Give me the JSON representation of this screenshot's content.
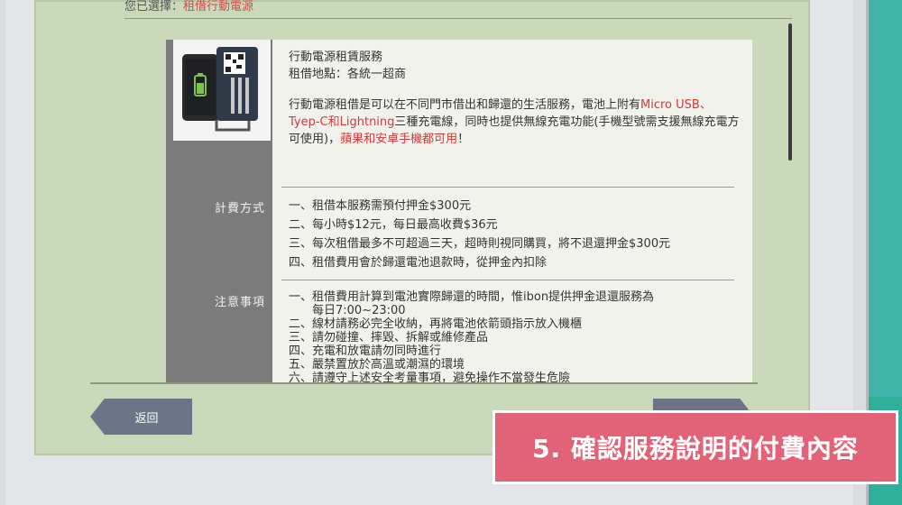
{
  "header": {
    "selected_prefix": "您已選擇：",
    "selected_value": "租借行動電源"
  },
  "service": {
    "title": "行動電源租賃服務",
    "location": "租借地點：各統一超商",
    "desc_part1": "行動電源租借是可以在不同門市借出和歸還的生活服務，電池上附有",
    "desc_red1": "Micro USB、Tyep-C和Lightning",
    "desc_part2": "三種充電線，同時也提供無線充電功能(手機型號需支援無線充電方可使用)，",
    "desc_red2": "蘋果和安卓手機都可用",
    "desc_part3": "！"
  },
  "sections": {
    "fees_label": "計費方式",
    "fees": [
      "一、租借本服務需預付押金$300元",
      "二、每小時$12元，每日最高收費$36元",
      "三、每次租借最多不可超過三天，超時則視同購買，將不退還押金$300元",
      "四、租借費用會於歸還電池退款時，從押金內扣除"
    ],
    "notes_label": "注意事項",
    "notes": [
      "一、租借費用計算到電池實際歸還的時間，惟ibon提供押金退還服務為",
      "　　每日7:00~23:00",
      "二、線材請務必完全收納，再將電池依箭頭指示放入機櫃",
      "三、請勿碰撞、摔毀、拆解或維修產品",
      "四、充電和放電請勿同時進行",
      "五、嚴禁置放於高溫或潮濕的環境",
      "六、請遵守上述安全考量事項，避免操作不當發生危險"
    ]
  },
  "buttons": {
    "back_label": "返回"
  },
  "caption": {
    "text": "5. 確認服務說明的付費內容"
  },
  "colors": {
    "accent_red": "#d63838",
    "caption_bg": "#e26377",
    "screen_bg": "#c9d9b9"
  }
}
